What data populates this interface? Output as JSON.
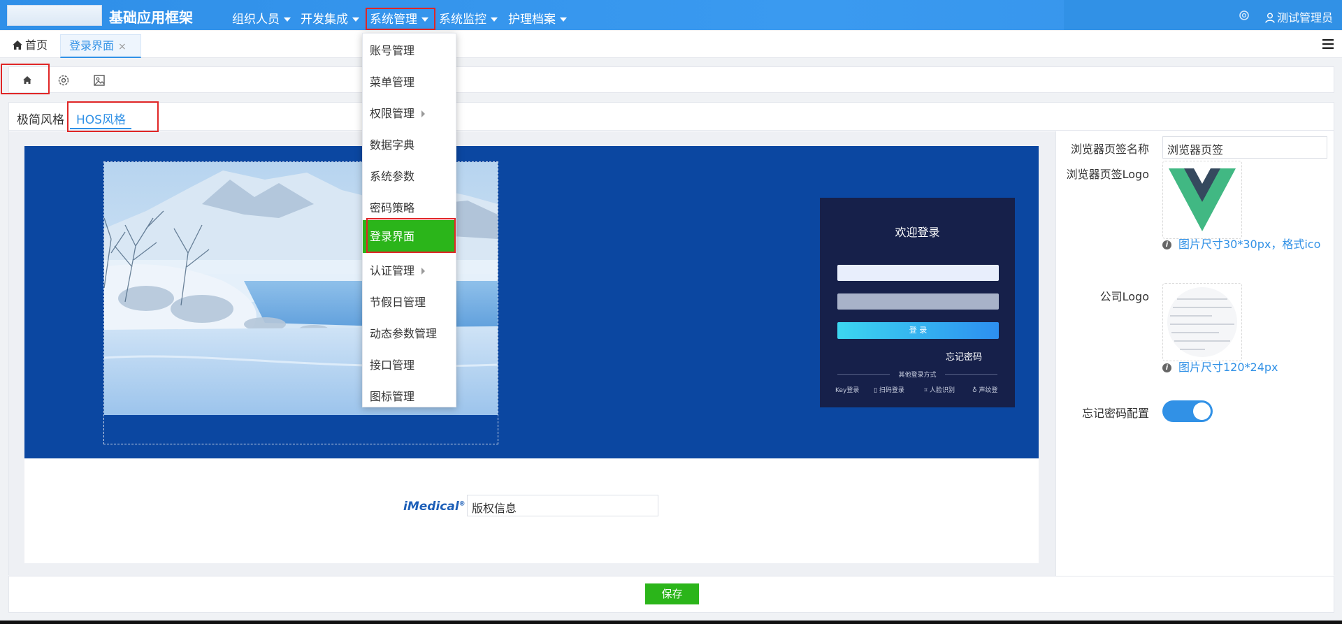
{
  "app": {
    "title": "基础应用框架"
  },
  "nav": {
    "items": [
      {
        "label": "组织人员"
      },
      {
        "label": "开发集成"
      },
      {
        "label": "系统管理"
      },
      {
        "label": "系统监控"
      },
      {
        "label": "护理档案"
      }
    ],
    "user": "测试管理员"
  },
  "tabs": {
    "home": "首页",
    "current": "登录界面",
    "close": "×"
  },
  "dropdown": {
    "items": [
      {
        "label": "账号管理"
      },
      {
        "label": "菜单管理"
      },
      {
        "label": "权限管理"
      },
      {
        "label": "数据字典"
      },
      {
        "label": "系统参数"
      },
      {
        "label": "密码策略"
      },
      {
        "label": "登录界面"
      },
      {
        "label": "认证管理"
      },
      {
        "label": "节假日管理"
      },
      {
        "label": "动态参数管理"
      },
      {
        "label": "接口管理"
      },
      {
        "label": "图标管理"
      }
    ]
  },
  "subtabs": {
    "simple": "极简风格",
    "hos": "HOS风格"
  },
  "login_preview": {
    "welcome": "欢迎登录",
    "button": "登 录",
    "forgot": "忘记密码",
    "divider": "其他登录方式",
    "methods": [
      "Key登录",
      "扫码登录",
      "人脸识别",
      "声纹登"
    ]
  },
  "footer": {
    "brand": "iMedical",
    "brand_mark": "®",
    "copyright_value": "版权信息"
  },
  "config": {
    "tab_title_label": "浏览器页签名称",
    "tab_title_value": "浏览器页签",
    "tab_logo_label": "浏览器页签Logo",
    "tab_logo_hint": "图片尺寸30*30px，格式ico",
    "company_logo_label": "公司Logo",
    "company_logo_hint": "图片尺寸120*24px",
    "forgot_config_label": "忘记密码配置",
    "forgot_config_on": true
  },
  "actions": {
    "save": "保存"
  },
  "colors": {
    "primary": "#3191e6",
    "nav_bg": "#3593ea",
    "success": "#2bb51a",
    "highlight": "#e02626",
    "preview_bg": "#0b47a1",
    "login_card": "#16204a"
  }
}
